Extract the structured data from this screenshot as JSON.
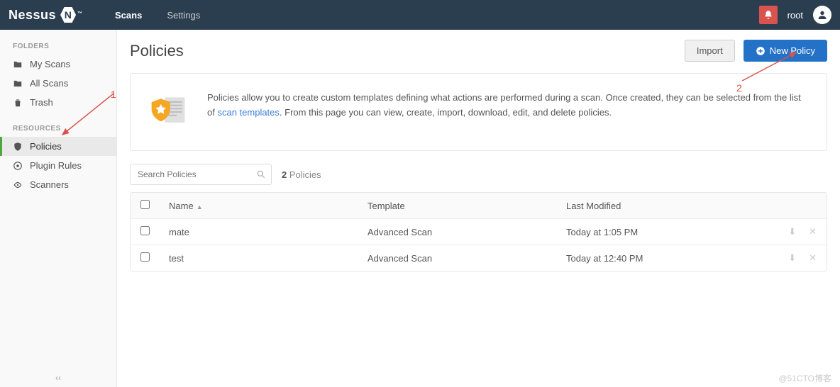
{
  "brand": "Nessus",
  "brand_mark": "N",
  "nav": {
    "scans": "Scans",
    "settings": "Settings"
  },
  "user": "root",
  "sidebar": {
    "folders_h": "FOLDERS",
    "resources_h": "RESOURCES",
    "folders": [
      {
        "label": "My Scans"
      },
      {
        "label": "All Scans"
      },
      {
        "label": "Trash"
      }
    ],
    "resources": [
      {
        "label": "Policies"
      },
      {
        "label": "Plugin Rules"
      },
      {
        "label": "Scanners"
      }
    ]
  },
  "page": {
    "title": "Policies",
    "import": "Import",
    "new": "New Policy",
    "info_1": "Policies allow you to create custom templates defining what actions are performed during a scan. Once created, they can be selected from the list of ",
    "info_link": "scan templates",
    "info_2": ". From this page you can view, create, import, download, edit, and delete policies.",
    "search_ph": "Search Policies",
    "count_n": "2",
    "count_lbl": "Policies"
  },
  "table": {
    "cols": {
      "name": "Name",
      "tmpl": "Template",
      "mod": "Last Modified"
    },
    "rows": [
      {
        "name": "mate",
        "tmpl": "Advanced Scan",
        "mod": "Today at 1:05 PM"
      },
      {
        "name": "test",
        "tmpl": "Advanced Scan",
        "mod": "Today at 12:40 PM"
      }
    ]
  },
  "ann": {
    "one": "1",
    "two": "2"
  },
  "watermark": "@51CTO博客"
}
